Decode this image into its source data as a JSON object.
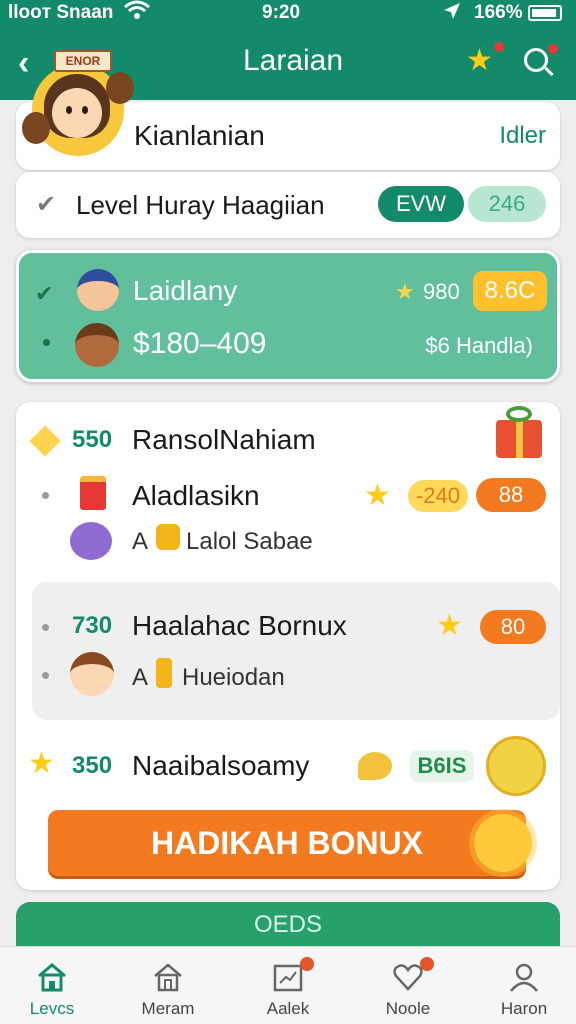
{
  "status_bar": {
    "carrier": "llooᴛ Snaan",
    "time": "9:20",
    "battery": "166%"
  },
  "header": {
    "title": "Laraian",
    "mascot_sign": "ENOR",
    "accent": "#138a6a"
  },
  "title_card": {
    "title": "Kianlanian",
    "link": "Idler"
  },
  "level_card": {
    "label": "Level Huray Haagiian",
    "pill_primary": "EVW",
    "pill_secondary": "246"
  },
  "highlight_card": {
    "name": "Laidlany",
    "range": "$180–409",
    "points": "980",
    "badge": "8.6C",
    "meta": "$6 Handla)"
  },
  "list": {
    "row1": {
      "num": "550",
      "title": "RansolNahiam"
    },
    "row2": {
      "title": "Aladlasikn",
      "pill_yellow": "-240",
      "pill_orange": "88"
    },
    "row3": {
      "prefix": "A",
      "text": "Lalol Sabae"
    },
    "row4": {
      "num": "730",
      "title": "Haalahac Bornux",
      "pill": "80"
    },
    "row5": {
      "prefix": "A",
      "text": "Hueiodan"
    },
    "row6": {
      "num": "350",
      "title": "Naaibalsoamy",
      "pill": "B6IS"
    },
    "cta": "HADIKAH BONUX"
  },
  "footer_button": "OEDS",
  "bottom_nav": [
    {
      "label": "Levcs",
      "icon": "home-icon",
      "active": true
    },
    {
      "label": "Meram",
      "icon": "house-icon",
      "active": false
    },
    {
      "label": "Aalek",
      "icon": "chart-icon",
      "active": false
    },
    {
      "label": "Noole",
      "icon": "heart-icon",
      "active": false
    },
    {
      "label": "Haron",
      "icon": "profile-icon",
      "active": false
    }
  ]
}
